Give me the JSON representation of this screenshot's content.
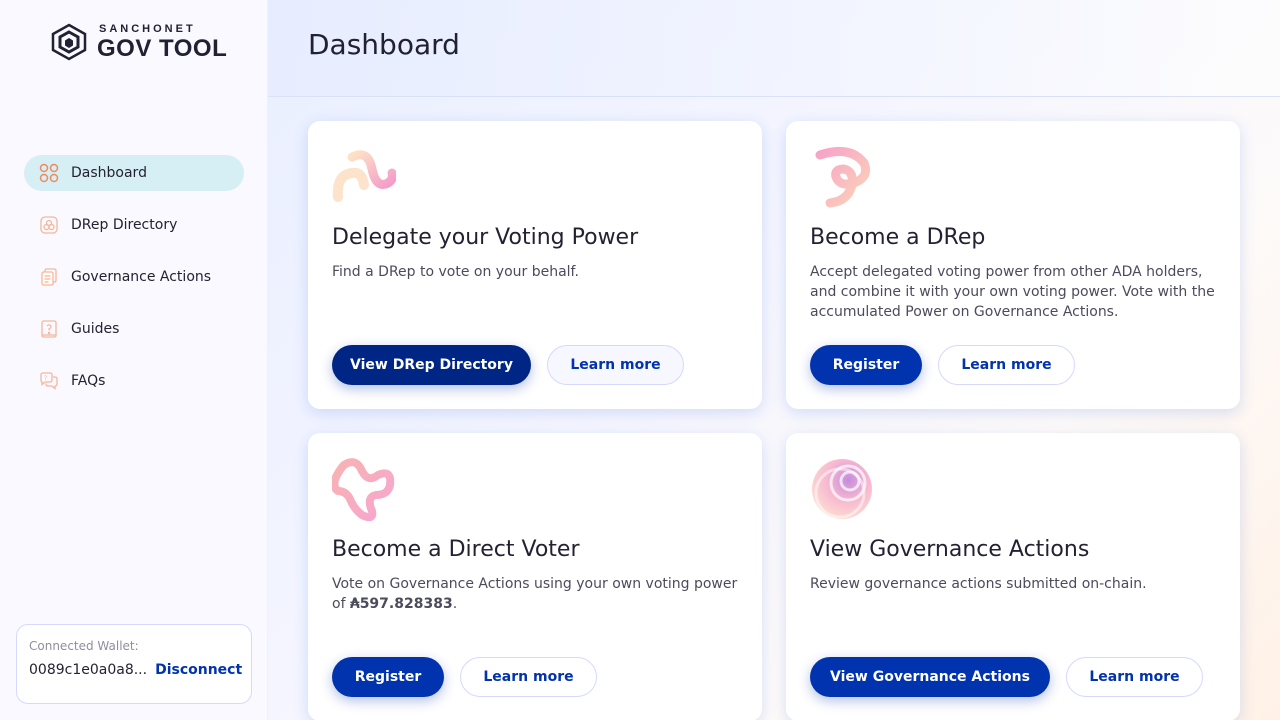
{
  "sidebar": {
    "logo_top": "SANCHONET",
    "logo_bottom": "GOV TOOL",
    "items": [
      {
        "label": "Dashboard",
        "icon": "dashboard-icon",
        "active": true
      },
      {
        "label": "DRep Directory",
        "icon": "drep-directory-icon",
        "active": false
      },
      {
        "label": "Governance Actions",
        "icon": "governance-actions-icon",
        "active": false
      },
      {
        "label": "Guides",
        "icon": "guides-icon",
        "active": false
      },
      {
        "label": "FAQs",
        "icon": "faqs-icon",
        "active": false
      }
    ],
    "wallet": {
      "label": "Connected Wallet:",
      "address": "0089c1e0a0a8...",
      "disconnect": "Disconnect"
    }
  },
  "header": {
    "title": "Dashboard"
  },
  "cards": [
    {
      "title": "Delegate your Voting Power",
      "desc": "Find a DRep to vote on your behalf.",
      "primary": "View DRep Directory",
      "secondary": "Learn more"
    },
    {
      "title": "Become a DRep",
      "desc": "Accept delegated voting power from other ADA holders, and combine it with your own voting power. Vote with the accumulated Power on Governance Actions.",
      "primary": "Register",
      "secondary": "Learn more"
    },
    {
      "title": "Become a Direct Voter",
      "desc_prefix": "Vote on Governance Actions using your own voting power of ",
      "desc_amount": "₳597.828383",
      "desc_suffix": ".",
      "primary": "Register",
      "secondary": "Learn more"
    },
    {
      "title": "View Governance Actions",
      "desc": "Review governance actions submitted on-chain.",
      "primary": "View Governance Actions",
      "secondary": "Learn more"
    }
  ],
  "colors": {
    "accent": "#0033ad",
    "nav_active_bg": "#d6eff5",
    "icon_orange": "#f08a5d"
  }
}
